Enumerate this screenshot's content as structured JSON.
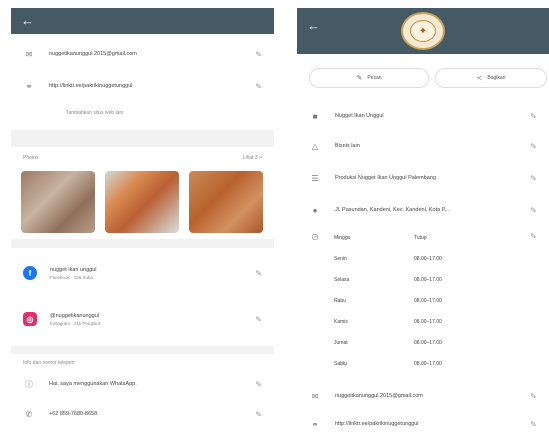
{
  "left": {
    "contact": {
      "email": "nuggetikanunggul.2015@gmail.com",
      "website": "http://linktr.ee/pakrikinuggetunggul",
      "add_other": "Tambahkan situs web lain"
    },
    "photos": {
      "title": "Photos",
      "see_all": "Lihat 3 >"
    },
    "social": [
      {
        "name": "nugget ikan unggul",
        "sub": "Facebook · 156 Suka",
        "brand_icon": "facebook-icon",
        "brand_glyph": "f",
        "color": "#1877f2"
      },
      {
        "name": "@nuggetikanunggul",
        "sub": "Instagram · 211 Pengikut",
        "brand_icon": "instagram-icon",
        "brand_glyph": "◎",
        "color": "#e1306c"
      }
    ],
    "whatsapp": {
      "title": "Info dan nomor telepon",
      "status": "Hai, saya menggunakan WhatsApp.",
      "phone": "+62 859-7680-8658"
    }
  },
  "right": {
    "buttons": {
      "message": "Pesan",
      "share": "Bagikan"
    },
    "info": {
      "name": "Nugget Ikan Unggul",
      "category": "Bisnis lain",
      "description": "Produksi Nugget Ikan Unggul Palembang",
      "address": "Jl. Pasundan, Kandeni, Kec. Kandeni, Kota P..."
    },
    "hours": [
      {
        "day": "Minggu",
        "time": "Tutup"
      },
      {
        "day": "Senin",
        "time": "08.00–17.00"
      },
      {
        "day": "Selasa",
        "time": "08.00–17.00"
      },
      {
        "day": "Rabu",
        "time": "08.00–17.00"
      },
      {
        "day": "Kamis",
        "time": "08.00–17.00"
      },
      {
        "day": "Jumat",
        "time": "08.00–17.00"
      },
      {
        "day": "Sabtu",
        "time": "08.00–17.00"
      }
    ],
    "contact": {
      "email": "nuggetikanunggul.2015@gmail.com",
      "website": "http://linktr.ee/pakrikinuggetunggul"
    }
  }
}
